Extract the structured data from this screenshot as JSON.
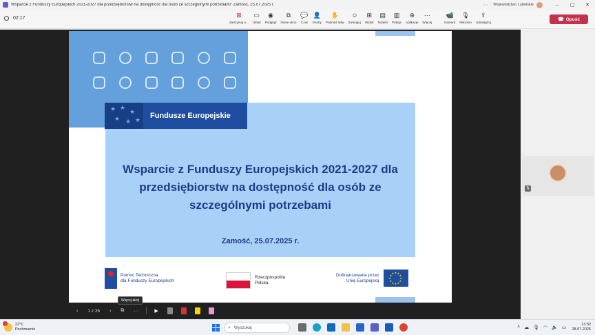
{
  "window": {
    "title": "Wsparcie z Funduszy Europejskich 2021-2027 dla przedsiębiorstw na dostępność dla osób ze szczególnymi potrzebami\" Zamość, 25.07.2025 r.",
    "organization": "Województwo Lubelskie",
    "controls": {
      "more": "···",
      "minimize": "–",
      "maximize": "▢",
      "close": "✕"
    }
  },
  "toolbar": {
    "timer": "02:17",
    "items": [
      {
        "icon": "stop-share-icon",
        "glyph": "⊠",
        "label": "Zatrzymaj u..."
      },
      {
        "icon": "layout-icon",
        "glyph": "▭",
        "label": "Układ"
      },
      {
        "icon": "broadcast-icon",
        "glyph": "◉",
        "label": "Podgląd"
      },
      {
        "icon": "new-window-icon",
        "glyph": "⧉",
        "label": "Nowe okno"
      },
      {
        "icon": "chat-icon",
        "glyph": "💬",
        "label": "Czat"
      },
      {
        "icon": "people-icon",
        "glyph": "👤",
        "label": "Osoby"
      },
      {
        "icon": "raise-hand-icon",
        "glyph": "✋",
        "label": "Podnieś rękę"
      },
      {
        "icon": "react-icon",
        "glyph": "☺",
        "label": "Zareaguj"
      },
      {
        "icon": "view-icon",
        "glyph": "⊞",
        "label": "Widok"
      },
      {
        "icon": "notes-icon",
        "glyph": "▤",
        "label": "Notatki"
      },
      {
        "icon": "rooms-icon",
        "glyph": "▥",
        "label": "Pokoje"
      },
      {
        "icon": "apps-icon",
        "glyph": "⊕",
        "label": "Aplikacje"
      },
      {
        "icon": "more-icon",
        "glyph": "···",
        "label": "Więcej"
      },
      {
        "icon": "camera-icon",
        "glyph": "📹",
        "label": "Kamera"
      },
      {
        "icon": "mic-muted-icon",
        "glyph": "🎙",
        "label": "Mikrofon"
      },
      {
        "icon": "share-icon",
        "glyph": "⇪",
        "label": "Udostępnij"
      }
    ],
    "leave_label": "Opuść"
  },
  "slide": {
    "fe_label": "Fundusze Europejskie",
    "title": "Wsparcie z Funduszy Europejskich 2021-2027  dla przedsiębiorstw  na dostępność dla osób ze szczególnymi potrzebami",
    "date": "Zamość, 25.07.2025 r.",
    "logo_pt_line1": "Pomoc Techniczna",
    "logo_pt_line2": "dla Funduszy Europejskich",
    "logo_rp_line1": "Rzeczpospolita",
    "logo_rp_line2": "Polska",
    "logo_eu_line1": "Dofinansowane przez",
    "logo_eu_line2": "Unię Europejską"
  },
  "presentation": {
    "prev": "‹",
    "pages": "1 z 25",
    "next": "›",
    "tooltip": "Więcej akcji",
    "more": "···"
  },
  "taskbar": {
    "weather_badge": "1",
    "temperature": "22°C",
    "weather_desc": "Pochmurnie",
    "search_placeholder": "Wyszukaj",
    "time": "13:32",
    "date": "28.07.2025"
  }
}
